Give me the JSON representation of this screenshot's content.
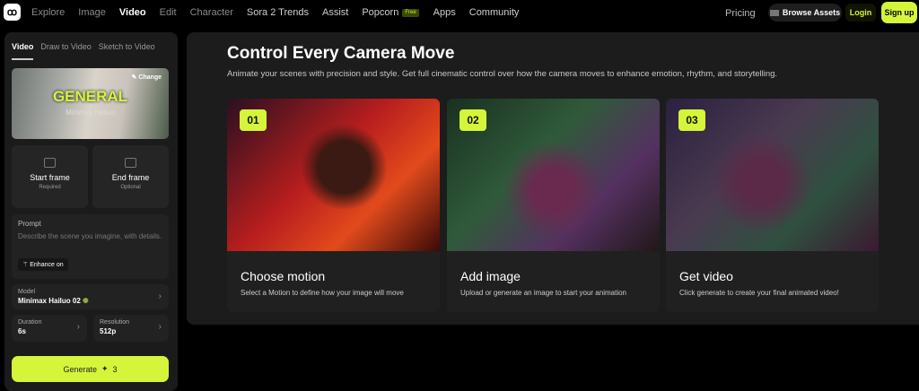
{
  "nav": {
    "logo": "ꝏ",
    "links": [
      "Explore",
      "Image",
      "Video",
      "Edit",
      "Character",
      "Sora 2 Trends",
      "Assist",
      "Popcorn",
      "Apps",
      "Community"
    ],
    "popcorn_badge": "Free",
    "pricing": "Pricing",
    "browse": "Browse Assets",
    "login": "Login",
    "signup": "Sign up"
  },
  "sidebar": {
    "tabs": [
      "Video",
      "Draw to Video",
      "Sketch to Video"
    ],
    "model_card": {
      "title": "GENERAL",
      "subtitle": "Minimax Hailuo",
      "change": "✎ Change"
    },
    "start_frame": {
      "label": "Start frame",
      "note": "Required"
    },
    "end_frame": {
      "label": "End frame",
      "note": "Optional"
    },
    "prompt": {
      "label": "Prompt",
      "placeholder": "Describe the scene you imagine, with details.",
      "enhance": "Enhance on"
    },
    "model": {
      "label": "Model",
      "value": "Minimax Hailuo 02"
    },
    "duration": {
      "label": "Duration",
      "value": "6s"
    },
    "resolution": {
      "label": "Resolution",
      "value": "512p"
    },
    "generate": {
      "label": "Generate",
      "cost": "3"
    }
  },
  "main": {
    "title": "Control Every Camera Move",
    "description": "Animate your scenes with precision and style. Get full cinematic control over how the camera moves to enhance emotion, rhythm, and storytelling.",
    "steps": [
      {
        "num": "01",
        "title": "Choose motion",
        "desc": "Select a Motion to define how your image will move"
      },
      {
        "num": "02",
        "title": "Add image",
        "desc": "Upload or generate an image to start your animation"
      },
      {
        "num": "03",
        "title": "Get video",
        "desc": "Click generate to create your final animated video!"
      }
    ]
  },
  "colors": {
    "accent": "#d4f53a",
    "panel": "#1c1c1c"
  }
}
